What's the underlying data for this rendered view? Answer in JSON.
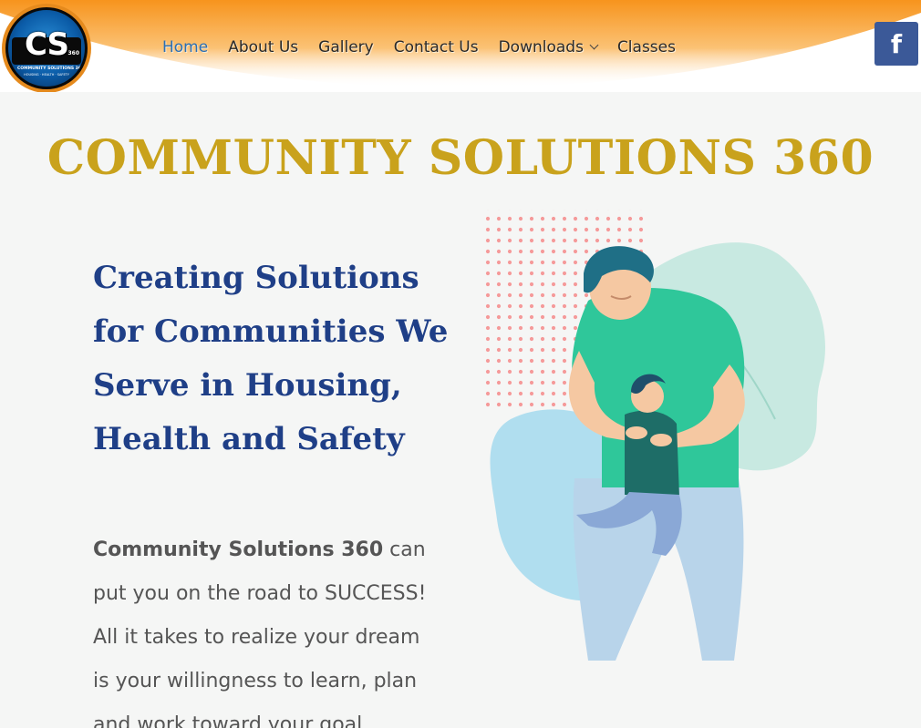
{
  "logo": {
    "initials": "CS",
    "number": "360",
    "company": "COMMUNITY SOLUTIONS 360",
    "tagline": "HOUSING · HEALTH · SAFETY"
  },
  "nav": {
    "items": [
      {
        "label": "Home",
        "active": true
      },
      {
        "label": "About Us"
      },
      {
        "label": "Gallery"
      },
      {
        "label": "Contact Us"
      },
      {
        "label": "Downloads",
        "has_dropdown": true
      },
      {
        "label": "Classes"
      }
    ]
  },
  "social": {
    "facebook_label": "f"
  },
  "hero": {
    "site_title": "COMMUNITY SOLUTIONS 360",
    "headline_lines": [
      "Creating Solutions",
      "for Communities We",
      "Serve in Housing,",
      "Health and Safety"
    ],
    "body_bold": "Community Solutions 360",
    "body_first_rest": " can",
    "body_lines": [
      "put you on the road to SUCCESS!",
      "All it takes to realize your dream",
      "is your willingness to learn, plan",
      "and work toward your goal."
    ]
  },
  "colors": {
    "title_gold": "#c9a21c",
    "headline_blue": "#1f3f87",
    "nav_active": "#2b6fb3",
    "header_orange": "#f7941d",
    "facebook_blue": "#3b5998"
  }
}
